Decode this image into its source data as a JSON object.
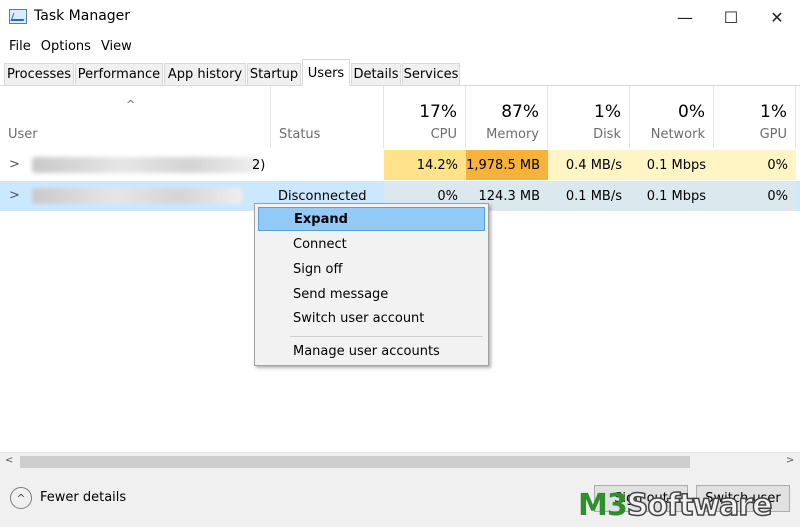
{
  "window": {
    "title": "Task Manager",
    "minimize": "—",
    "maximize": "☐",
    "close": "✕"
  },
  "menubar": [
    "File",
    "Options",
    "View"
  ],
  "tabs": [
    "Processes",
    "Performance",
    "App history",
    "Startup",
    "Users",
    "Details",
    "Services"
  ],
  "active_tab": "Users",
  "columns": {
    "user": "User",
    "status": "Status",
    "cpu": {
      "pct": "17%",
      "label": "CPU"
    },
    "memory": {
      "pct": "87%",
      "label": "Memory"
    },
    "disk": {
      "pct": "1%",
      "label": "Disk"
    },
    "network": {
      "pct": "0%",
      "label": "Network"
    },
    "gpu": {
      "pct": "1%",
      "label": "GPU"
    }
  },
  "rows": [
    {
      "name_suffix": "2)",
      "status": "",
      "cpu": "14.2%",
      "memory": "1,978.5 MB",
      "disk": "0.4 MB/s",
      "network": "0.1 Mbps",
      "gpu": "0%"
    },
    {
      "name_suffix": "",
      "status": "Disconnected",
      "cpu": "0%",
      "memory": "124.3 MB",
      "disk": "0.1 MB/s",
      "network": "0.1 Mbps",
      "gpu": "0%"
    }
  ],
  "context_menu": [
    "Expand",
    "Connect",
    "Sign off",
    "Send message",
    "Switch user account",
    "Manage user accounts"
  ],
  "footer": {
    "fewer_details": "Fewer details",
    "sign_out": "Sign out",
    "switch_user": "Switch user"
  },
  "watermark": {
    "brand_a": "M3",
    "brand_b": "Software"
  },
  "colors": {
    "cpu_high": "#fff4c4",
    "cpu_cell": "#ffe28a",
    "memory_cell": "#f7b23b",
    "selected_row": "#cce8ff",
    "menu_highlight": "#91c9f7"
  }
}
